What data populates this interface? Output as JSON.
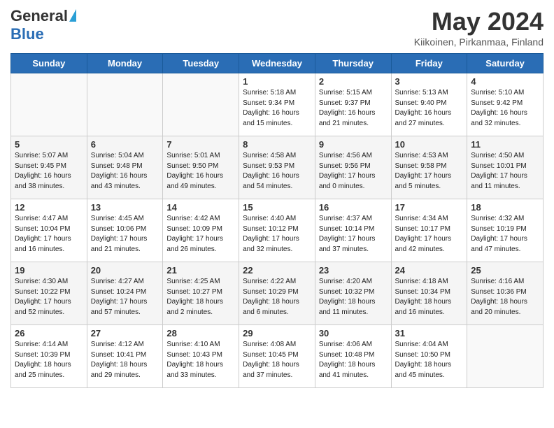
{
  "logo": {
    "general": "General",
    "blue": "Blue"
  },
  "title": "May 2024",
  "location": "Kiikoinen, Pirkanmaa, Finland",
  "days_of_week": [
    "Sunday",
    "Monday",
    "Tuesday",
    "Wednesday",
    "Thursday",
    "Friday",
    "Saturday"
  ],
  "weeks": [
    [
      {
        "day": "",
        "info": ""
      },
      {
        "day": "",
        "info": ""
      },
      {
        "day": "",
        "info": ""
      },
      {
        "day": "1",
        "info": "Sunrise: 5:18 AM\nSunset: 9:34 PM\nDaylight: 16 hours\nand 15 minutes."
      },
      {
        "day": "2",
        "info": "Sunrise: 5:15 AM\nSunset: 9:37 PM\nDaylight: 16 hours\nand 21 minutes."
      },
      {
        "day": "3",
        "info": "Sunrise: 5:13 AM\nSunset: 9:40 PM\nDaylight: 16 hours\nand 27 minutes."
      },
      {
        "day": "4",
        "info": "Sunrise: 5:10 AM\nSunset: 9:42 PM\nDaylight: 16 hours\nand 32 minutes."
      }
    ],
    [
      {
        "day": "5",
        "info": "Sunrise: 5:07 AM\nSunset: 9:45 PM\nDaylight: 16 hours\nand 38 minutes."
      },
      {
        "day": "6",
        "info": "Sunrise: 5:04 AM\nSunset: 9:48 PM\nDaylight: 16 hours\nand 43 minutes."
      },
      {
        "day": "7",
        "info": "Sunrise: 5:01 AM\nSunset: 9:50 PM\nDaylight: 16 hours\nand 49 minutes."
      },
      {
        "day": "8",
        "info": "Sunrise: 4:58 AM\nSunset: 9:53 PM\nDaylight: 16 hours\nand 54 minutes."
      },
      {
        "day": "9",
        "info": "Sunrise: 4:56 AM\nSunset: 9:56 PM\nDaylight: 17 hours\nand 0 minutes."
      },
      {
        "day": "10",
        "info": "Sunrise: 4:53 AM\nSunset: 9:58 PM\nDaylight: 17 hours\nand 5 minutes."
      },
      {
        "day": "11",
        "info": "Sunrise: 4:50 AM\nSunset: 10:01 PM\nDaylight: 17 hours\nand 11 minutes."
      }
    ],
    [
      {
        "day": "12",
        "info": "Sunrise: 4:47 AM\nSunset: 10:04 PM\nDaylight: 17 hours\nand 16 minutes."
      },
      {
        "day": "13",
        "info": "Sunrise: 4:45 AM\nSunset: 10:06 PM\nDaylight: 17 hours\nand 21 minutes."
      },
      {
        "day": "14",
        "info": "Sunrise: 4:42 AM\nSunset: 10:09 PM\nDaylight: 17 hours\nand 26 minutes."
      },
      {
        "day": "15",
        "info": "Sunrise: 4:40 AM\nSunset: 10:12 PM\nDaylight: 17 hours\nand 32 minutes."
      },
      {
        "day": "16",
        "info": "Sunrise: 4:37 AM\nSunset: 10:14 PM\nDaylight: 17 hours\nand 37 minutes."
      },
      {
        "day": "17",
        "info": "Sunrise: 4:34 AM\nSunset: 10:17 PM\nDaylight: 17 hours\nand 42 minutes."
      },
      {
        "day": "18",
        "info": "Sunrise: 4:32 AM\nSunset: 10:19 PM\nDaylight: 17 hours\nand 47 minutes."
      }
    ],
    [
      {
        "day": "19",
        "info": "Sunrise: 4:30 AM\nSunset: 10:22 PM\nDaylight: 17 hours\nand 52 minutes."
      },
      {
        "day": "20",
        "info": "Sunrise: 4:27 AM\nSunset: 10:24 PM\nDaylight: 17 hours\nand 57 minutes."
      },
      {
        "day": "21",
        "info": "Sunrise: 4:25 AM\nSunset: 10:27 PM\nDaylight: 18 hours\nand 2 minutes."
      },
      {
        "day": "22",
        "info": "Sunrise: 4:22 AM\nSunset: 10:29 PM\nDaylight: 18 hours\nand 6 minutes."
      },
      {
        "day": "23",
        "info": "Sunrise: 4:20 AM\nSunset: 10:32 PM\nDaylight: 18 hours\nand 11 minutes."
      },
      {
        "day": "24",
        "info": "Sunrise: 4:18 AM\nSunset: 10:34 PM\nDaylight: 18 hours\nand 16 minutes."
      },
      {
        "day": "25",
        "info": "Sunrise: 4:16 AM\nSunset: 10:36 PM\nDaylight: 18 hours\nand 20 minutes."
      }
    ],
    [
      {
        "day": "26",
        "info": "Sunrise: 4:14 AM\nSunset: 10:39 PM\nDaylight: 18 hours\nand 25 minutes."
      },
      {
        "day": "27",
        "info": "Sunrise: 4:12 AM\nSunset: 10:41 PM\nDaylight: 18 hours\nand 29 minutes."
      },
      {
        "day": "28",
        "info": "Sunrise: 4:10 AM\nSunset: 10:43 PM\nDaylight: 18 hours\nand 33 minutes."
      },
      {
        "day": "29",
        "info": "Sunrise: 4:08 AM\nSunset: 10:45 PM\nDaylight: 18 hours\nand 37 minutes."
      },
      {
        "day": "30",
        "info": "Sunrise: 4:06 AM\nSunset: 10:48 PM\nDaylight: 18 hours\nand 41 minutes."
      },
      {
        "day": "31",
        "info": "Sunrise: 4:04 AM\nSunset: 10:50 PM\nDaylight: 18 hours\nand 45 minutes."
      },
      {
        "day": "",
        "info": ""
      }
    ]
  ]
}
